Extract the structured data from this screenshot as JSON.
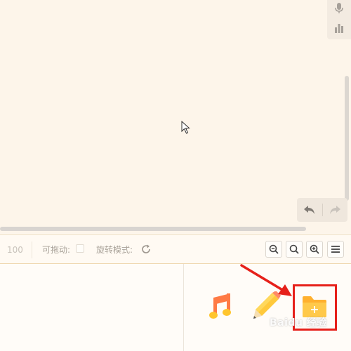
{
  "toolbar": {
    "zoom_value": "100",
    "draggable_label": "可拖动:",
    "rotate_mode_label": "旋转模式:",
    "icons": [
      "zoom-out-icon",
      "zoom-reset-icon",
      "zoom-in-icon",
      "menu-icon"
    ]
  },
  "side_tools": [
    "microphone-icon",
    "bar-chart-icon"
  ],
  "history": [
    "undo-icon",
    "redo-icon"
  ],
  "insert_panel": {
    "items": [
      "music-icon",
      "pencil-icon",
      "add-folder-icon"
    ],
    "highlighted": "add-folder-icon"
  },
  "watermark": "Baidu 经验",
  "colors": {
    "canvas_bg": "#fdf5ea",
    "highlight_red": "#e6201a",
    "folder_orange": "#ffb02e",
    "music_orange": "#ff7a45",
    "pencil_yellow": "#ffc93c"
  }
}
